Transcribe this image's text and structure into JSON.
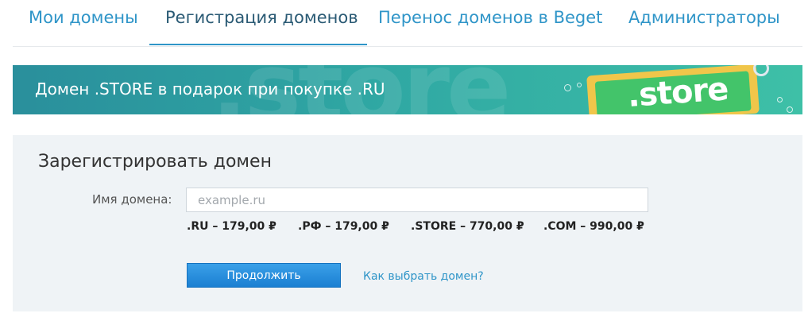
{
  "tabs": [
    {
      "label": "Мои домены"
    },
    {
      "label": "Регистрация доменов"
    },
    {
      "label": "Перенос доменов в Beget"
    },
    {
      "label": "Администраторы"
    }
  ],
  "banner": {
    "text": "Домен .STORE в подарок при покупке .RU",
    "bg_text": ".store",
    "logo_text": ".store"
  },
  "register": {
    "title": "Зарегистрировать домен",
    "domain_label": "Имя домена:",
    "domain_placeholder": "example.ru",
    "domain_value": "",
    "prices": [
      ".RU – 179,00 ₽",
      ".РФ – 179,00 ₽",
      ".STORE – 770,00 ₽",
      ".COM – 990,00 ₽"
    ],
    "continue_label": "Продолжить",
    "help_link": "Как выбрать домен?"
  },
  "colors": {
    "accent": "#2f95c8",
    "active_tab": "#2a5a74",
    "button": "#1b7fd2",
    "panel_bg": "#eff3f6",
    "banner_start": "#2a8f9c",
    "banner_end": "#3ec0a7"
  }
}
